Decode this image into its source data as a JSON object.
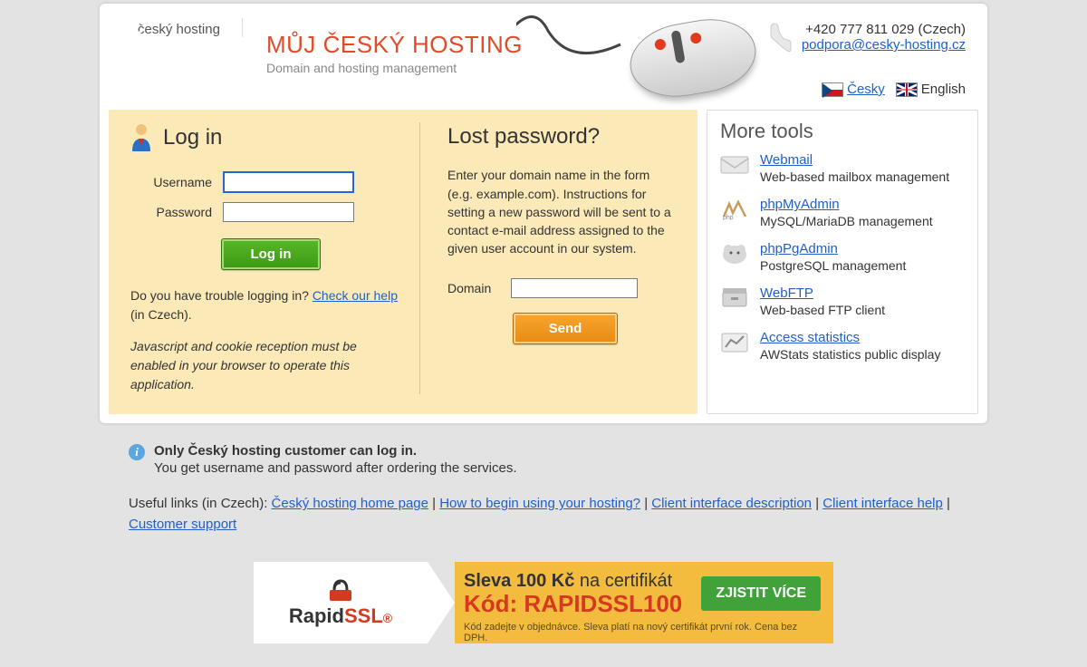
{
  "header": {
    "logo_text": "český hosting",
    "title": "MŮJ ČESKÝ HOSTING",
    "subtitle": "Domain and hosting management",
    "phone": "+420 777 811 029 (Czech)",
    "email": "podpora@cesky-hosting.cz",
    "lang_cs": "Česky",
    "lang_en": "English"
  },
  "login": {
    "title": "Log in",
    "username_label": "Username",
    "password_label": "Password",
    "button": "Log in",
    "help_prefix": "Do you have trouble logging in? ",
    "help_link": "Check our help",
    "help_suffix": " (in Czech).",
    "js_note": "Javascript and cookie reception must be enabled in your browser to operate this application."
  },
  "lost": {
    "title": "Lost password?",
    "desc": "Enter your domain name in the form (e.g. example.com). Instructions for setting a new password will be sent to a contact e-mail address assigned to the given user account in our system.",
    "domain_label": "Domain",
    "button": "Send"
  },
  "tools": {
    "title": "More tools",
    "items": [
      {
        "name": "Webmail",
        "desc": "Web-based mailbox management"
      },
      {
        "name": "phpMyAdmin",
        "desc": "MySQL/MariaDB management"
      },
      {
        "name": "phpPgAdmin",
        "desc": "PostgreSQL management"
      },
      {
        "name": "WebFTP",
        "desc": "Web-based FTP client"
      },
      {
        "name": "Access statistics",
        "desc": "AWStats statistics public display"
      }
    ]
  },
  "footer": {
    "info_bold": "Only Český hosting customer can log in.",
    "info_sub": "You get username and password after ordering the services.",
    "links_prefix": "Useful links (in Czech): ",
    "links": [
      "Český hosting home page",
      "How to begin using your hosting?",
      "Client interface description",
      "Client interface help",
      "Customer support"
    ]
  },
  "banner": {
    "brand": "RapidSSL",
    "line1a": "Sleva 100 Kč",
    "line1b": " na certifikát",
    "line2": "Kód: RAPIDSSL100",
    "line3": "Kód zadejte v objednávce. Sleva platí na nový certifikát první rok. Cena bez DPH.",
    "button": "ZJISTIT VÍCE"
  }
}
